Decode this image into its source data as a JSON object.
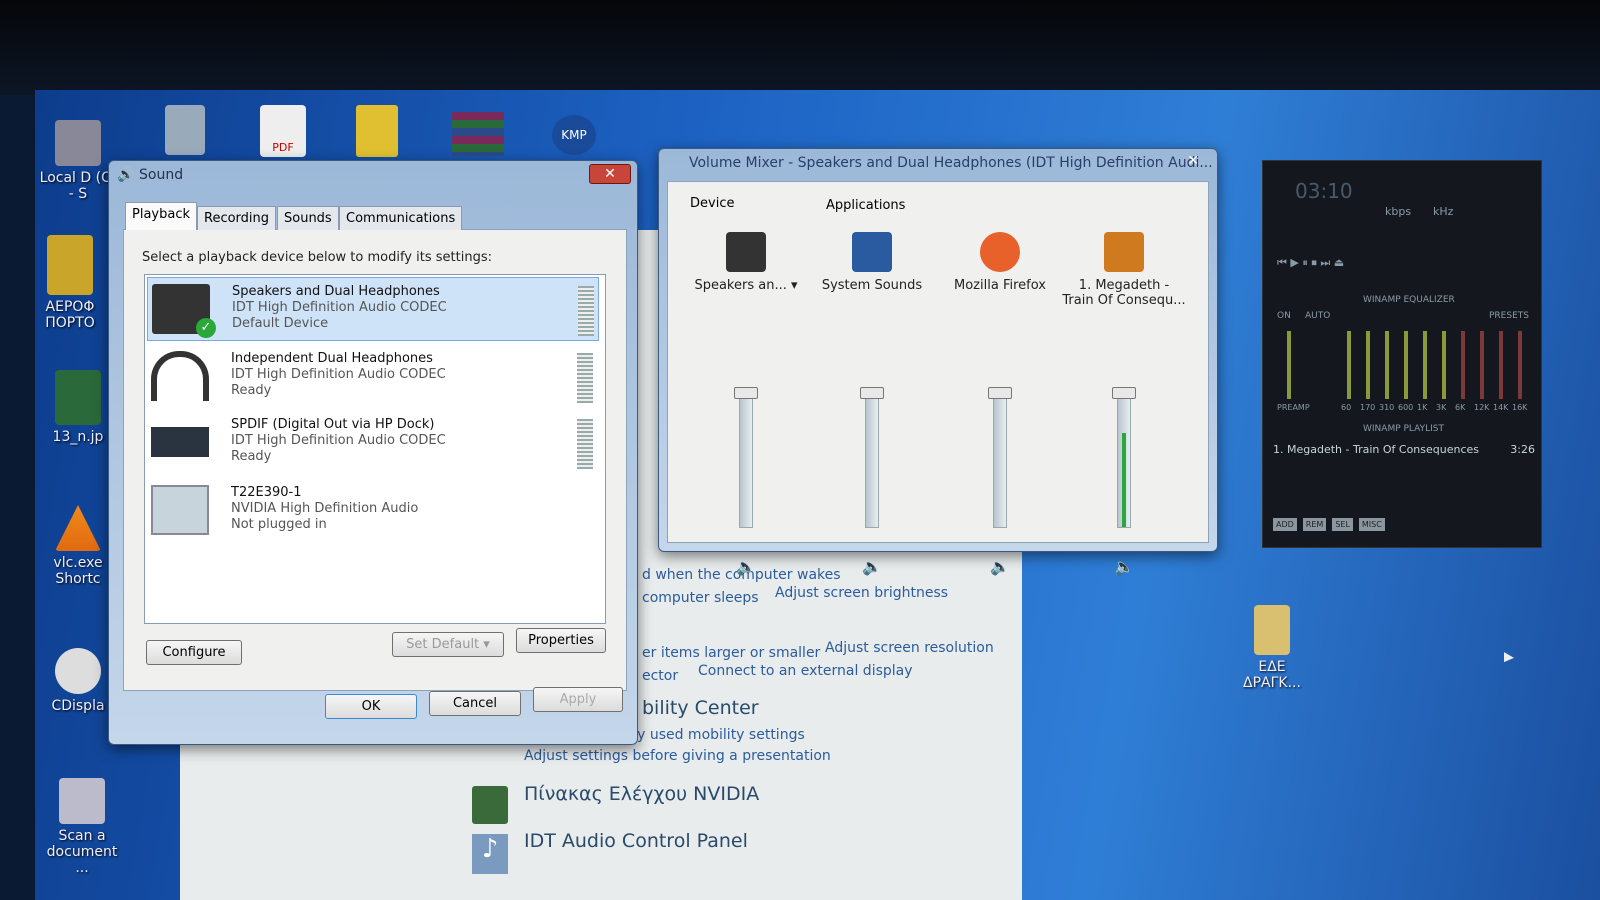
{
  "desktop": {
    "icons": [
      {
        "label": "Local D (C) - S"
      },
      {
        "label": "ΑΕΡΟΦ ΠΟΡΤΟ"
      },
      {
        "label": "13_n.jp"
      },
      {
        "label": "vlc.exe Shortc"
      },
      {
        "label": "CDispla"
      },
      {
        "label": "Scan a document ..."
      },
      {
        "label": "ΕΔΕ ΔΡΑΓΚ..."
      }
    ],
    "top_icons": [
      {
        "name": "recycle-bin"
      },
      {
        "name": "pdf"
      },
      {
        "name": "folder-archive"
      },
      {
        "name": "winrar"
      },
      {
        "name": "kmp",
        "label": "KMP"
      }
    ]
  },
  "control_panel": {
    "links": [
      "d when the computer wakes",
      "computer sleeps",
      "Adjust screen brightness",
      "er items larger or smaller",
      "Adjust screen resolution",
      "ector",
      "Connect to an external display",
      "Adjust commonly used mobility settings",
      "Adjust settings before giving a presentation"
    ],
    "headings": [
      "bility Center",
      "Πίνακας Ελέγχου NVIDIA",
      "IDT Audio Control Panel"
    ]
  },
  "sound": {
    "title": "Sound",
    "tabs": [
      "Playback",
      "Recording",
      "Sounds",
      "Communications"
    ],
    "active_tab": "Playback",
    "instruction": "Select a playback device below to modify its settings:",
    "devices": [
      {
        "name": "Speakers and Dual Headphones",
        "driver": "IDT High Definition Audio CODEC",
        "status": "Default Device",
        "selected": true,
        "default": true
      },
      {
        "name": "Independent Dual Headphones",
        "driver": "IDT High Definition Audio CODEC",
        "status": "Ready"
      },
      {
        "name": "SPDIF (Digital Out via HP Dock)",
        "driver": "IDT High Definition Audio CODEC",
        "status": "Ready"
      },
      {
        "name": "T22E390-1",
        "driver": "NVIDIA High Definition Audio",
        "status": "Not plugged in"
      }
    ],
    "configure": "Configure",
    "set_default": "Set Default",
    "properties": "Properties",
    "ok": "OK",
    "cancel": "Cancel",
    "apply": "Apply"
  },
  "mixer": {
    "title": "Volume Mixer - Speakers and Dual Headphones (IDT High Definition Audi...",
    "device_label": "Device",
    "apps_label": "Applications",
    "channels": [
      {
        "label": "Speakers an... ▾",
        "volume": 100,
        "level": 0
      },
      {
        "label": "System Sounds",
        "volume": 100,
        "level": 0
      },
      {
        "label": "Mozilla Firefox",
        "volume": 100,
        "level": 0
      },
      {
        "label": "1. Megadeth - Train Of Consequ...",
        "volume": 100,
        "level": 70
      }
    ]
  },
  "winamp": {
    "time": "03:10",
    "kbps": "kbps",
    "khz": "kHz",
    "eq_title": "WINAMP EQUALIZER",
    "eq_on": "ON",
    "eq_auto": "AUTO",
    "presets": "PRESETS",
    "preamp": "PREAMP",
    "bands": [
      "60",
      "170",
      "310",
      "600",
      "1K",
      "3K",
      "6K",
      "12K",
      "14K",
      "16K"
    ],
    "playlist_title": "WINAMP PLAYLIST",
    "track": "1. Megadeth - Train Of Consequences",
    "track_time": "3:26",
    "buttons": [
      "ADD",
      "REM",
      "SEL",
      "MISC"
    ]
  }
}
